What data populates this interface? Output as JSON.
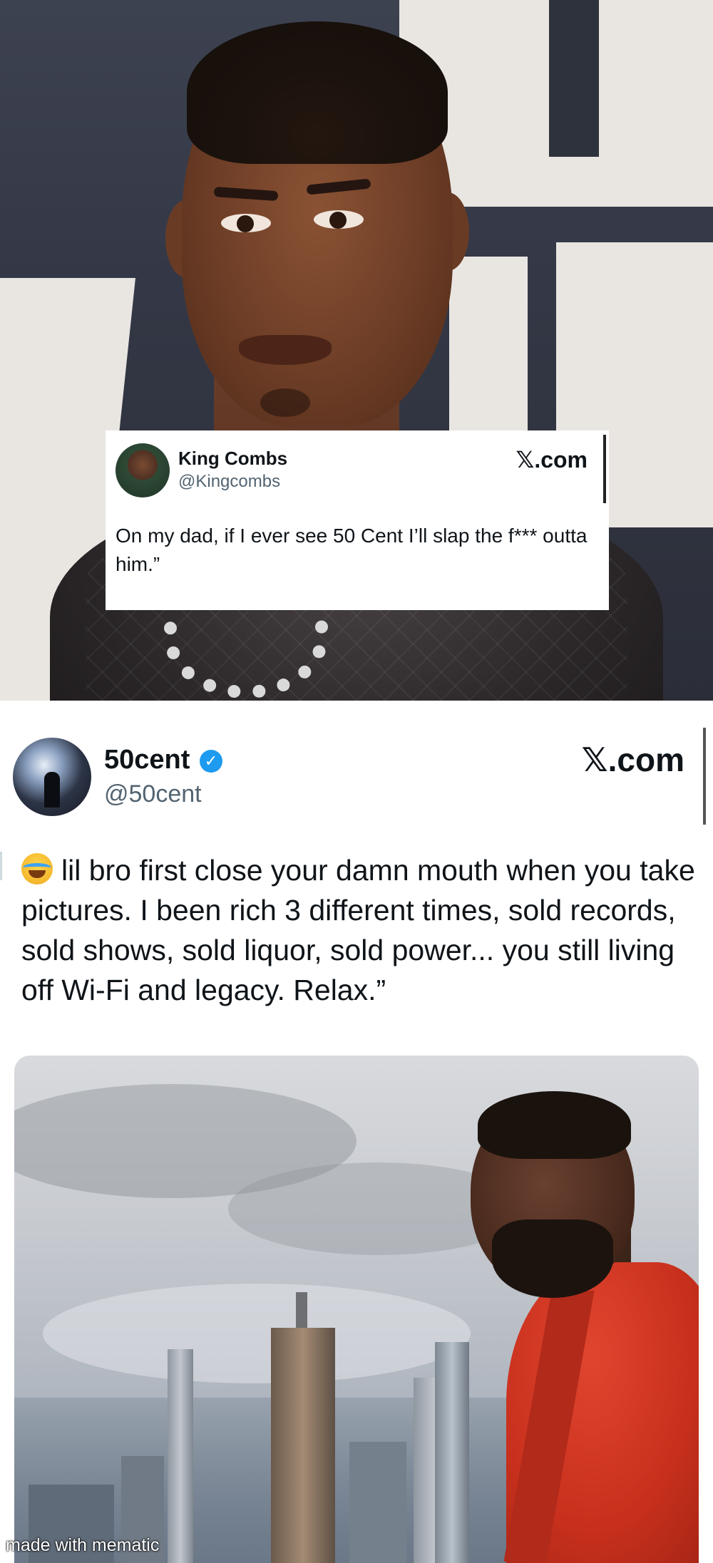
{
  "tweet1": {
    "name": "King Combs",
    "handle": "@Kingcombs",
    "brand": "𝕏.com",
    "text": "On my dad, if I ever see 50 Cent I’ll slap the f*** outta him.”"
  },
  "tweet2": {
    "name": "50cent",
    "verified_mark": "✓",
    "handle": "@50cent",
    "brand": "𝕏.com",
    "emoji": "laughing-crying-emoji",
    "text": "lil bro first close your damn mouth when you take pictures. I been rich 3 different times, sold records, sold shows, sold liquor, sold power... you still living off Wi-Fi and legacy. Relax.”"
  },
  "watermark": "made with mematic",
  "colors": {
    "verified_blue": "#1d9bf0",
    "handle_gray": "#536471",
    "text_dark": "#0f1419"
  }
}
